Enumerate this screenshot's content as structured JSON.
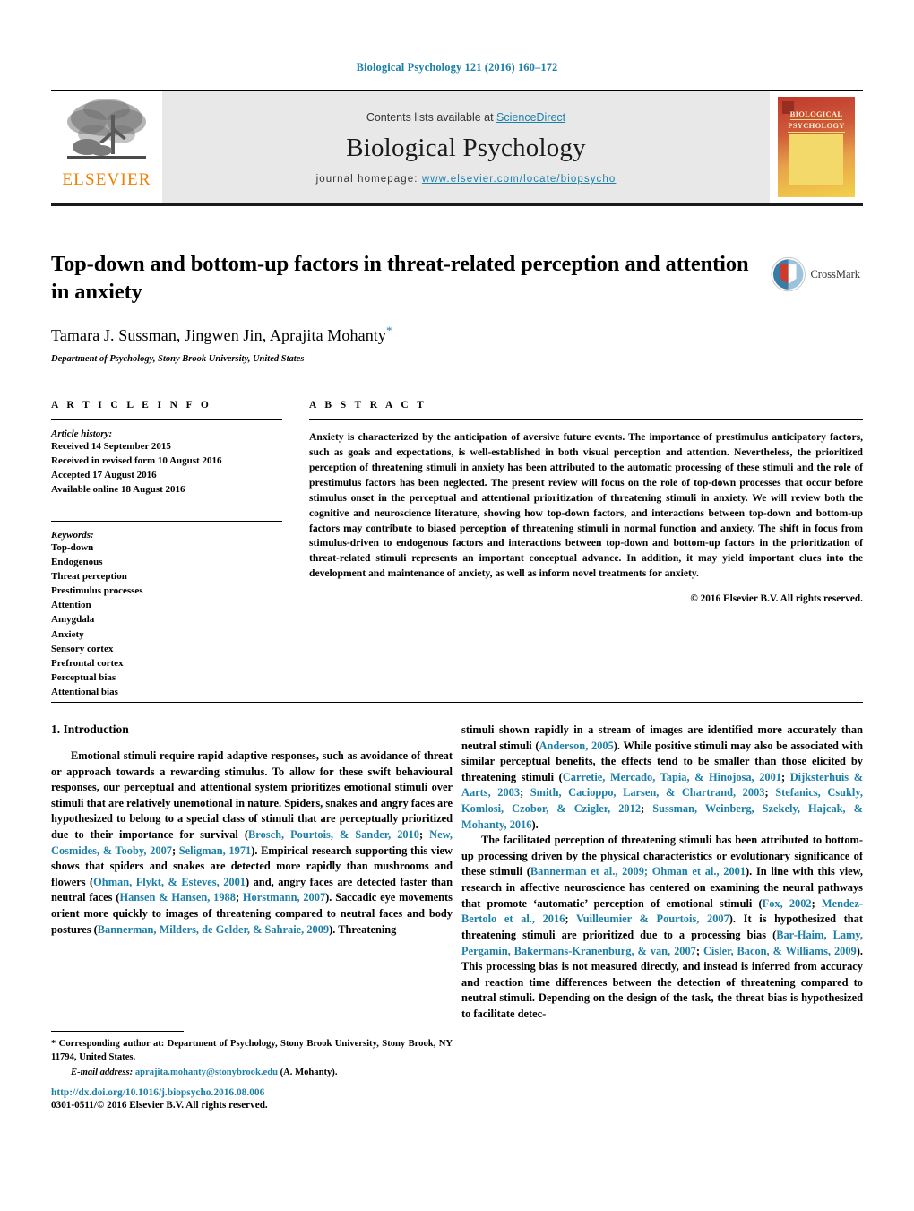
{
  "running_head": "Biological Psychology 121 (2016) 160–172",
  "masthead": {
    "contents_prefix": "Contents lists available at ",
    "sciencedirect": "ScienceDirect",
    "journal_title": "Biological Psychology",
    "homepage_prefix": "journal homepage: ",
    "homepage_url": "www.elsevier.com/locate/biopsycho",
    "publisher_wordmark": "ELSEVIER",
    "cover_title_line1": "BIOLOGICAL",
    "cover_title_line2": "PSYCHOLOGY"
  },
  "article": {
    "title": "Top-down and bottom-up factors in threat-related perception and attention in anxiety",
    "authors": "Tamara J. Sussman, Jingwen Jin, Aprajita Mohanty",
    "corresponding_marker": "*",
    "affiliation": "Department of Psychology, Stony Brook University, United States",
    "crossmark_label": "CrossMark"
  },
  "article_info": {
    "heading": "A R T I C L E   I N F O",
    "history_label": "Article history:",
    "history": [
      "Received 14 September 2015",
      "Received in revised form 10 August 2016",
      "Accepted 17 August 2016",
      "Available online 18 August 2016"
    ],
    "keywords_label": "Keywords:",
    "keywords": [
      "Top-down",
      "Endogenous",
      "Threat perception",
      "Prestimulus processes",
      "Attention",
      "Amygdala",
      "Anxiety",
      "Sensory cortex",
      "Prefrontal cortex",
      "Perceptual bias",
      "Attentional bias"
    ]
  },
  "abstract": {
    "heading": "A B S T R A C T",
    "text": "Anxiety is characterized by the anticipation of aversive future events. The importance of prestimulus anticipatory factors, such as goals and expectations, is well-established in both visual perception and attention. Nevertheless, the prioritized perception of threatening stimuli in anxiety has been attributed to the automatic processing of these stimuli and the role of prestimulus factors has been neglected. The present review will focus on the role of top-down processes that occur before stimulus onset in the perceptual and attentional prioritization of threatening stimuli in anxiety. We will review both the cognitive and neuroscience literature, showing how top-down factors, and interactions between top-down and bottom-up factors may contribute to biased perception of threatening stimuli in normal function and anxiety. The shift in focus from stimulus-driven to endogenous factors and interactions between top-down and bottom-up factors in the prioritization of threat-related stimuli represents an important conceptual advance. In addition, it may yield important clues into the development and maintenance of anxiety, as well as inform novel treatments for anxiety.",
    "copyright": "© 2016 Elsevier B.V. All rights reserved."
  },
  "body": {
    "section_heading": "1.  Introduction",
    "left_paragraph_1": {
      "p1": "Emotional stimuli require rapid adaptive responses, such as avoidance of threat or approach towards a rewarding stimulus. To allow for these swift behavioural responses, our perceptual and attentional system prioritizes emotional stimuli over stimuli that are relatively unemotional in nature. Spiders, snakes and angry faces are hypothesized to belong to a special class of stimuli that are perceptually prioritized due to their importance for survival (",
      "c1": "Brosch, Pourtois, & Sander, 2010",
      "p2": "; ",
      "c2": "New, Cosmides, & Tooby, 2007",
      "p3": "; ",
      "c3": "Seligman, 1971",
      "p4": "). Empirical research supporting this view shows that spiders and snakes are detected more rapidly than mushrooms and flowers (",
      "c4": "Ohman, Flykt, & Esteves, 2001",
      "p5": ") and, angry faces are detected faster than neutral faces (",
      "c5": "Hansen & Hansen, 1988",
      "p6": "; ",
      "c6": "Horstmann, 2007",
      "p7": "). Saccadic eye movements orient more quickly to images of threatening compared to neutral faces and body postures (",
      "c7": "Bannerman, Milders, de Gelder, & Sahraie, 2009",
      "p8": "). Threatening"
    },
    "right_paragraph_1": {
      "p1": "stimuli shown rapidly in a stream of images are identified more accurately than neutral stimuli (",
      "c1": "Anderson, 2005",
      "p2": "). While positive stimuli may also be associated with similar perceptual benefits, the effects tend to be smaller than those elicited by threatening stimuli (",
      "c2": "Carretie, Mercado, Tapia, & Hinojosa, 2001",
      "p3": "; ",
      "c3": "Dijksterhuis & Aarts, 2003",
      "p4": "; ",
      "c4": "Smith, Cacioppo, Larsen, & Chartrand, 2003",
      "p5": "; ",
      "c5": "Stefanics, Csukly, Komlosi, Czobor, & Czigler, 2012",
      "p6": "; ",
      "c6": "Sussman, Weinberg, Szekely, Hajcak, & Mohanty, 2016",
      "p7": ")."
    },
    "right_paragraph_2": {
      "p1": "The facilitated perception of threatening stimuli has been attributed to bottom-up processing driven by the physical characteristics or evolutionary significance of these stimuli (",
      "c1": "Bannerman et al., 2009; Ohman et al., 2001",
      "p2": "). In line with this view, research in affective neuroscience has centered on examining the neural pathways that promote ‘automatic’ perception of emotional stimuli (",
      "c2": "Fox, 2002",
      "p3": "; ",
      "c3": "Mendez-Bertolo et al., 2016",
      "p4": "; ",
      "c4": "Vuilleumier & Pourtois, 2007",
      "p5": "). It is hypothesized that threatening stimuli are prioritized due to a processing bias (",
      "c5": "Bar-Haim, Lamy, Pergamin, Bakermans-Kranenburg, & van, 2007",
      "p6": "; ",
      "c6": "Cisler, Bacon, & Williams, 2009",
      "p7": "). This processing bias is not measured directly, and instead is inferred from accuracy and reaction time differences between the detection of threatening compared to neutral stimuli. Depending on the design of the task, the threat bias is hypothesized to facilitate detec-"
    }
  },
  "footer": {
    "corresponding_marker": "*",
    "corresponding_text": " Corresponding author at: Department of Psychology, Stony Brook University, Stony Brook, NY 11794, United States.",
    "email_label": "E-mail address:",
    "email": "aprajita.mohanty@stonybrook.edu",
    "email_suffix": " (A. Mohanty).",
    "doi": "http://dx.doi.org/10.1016/j.biopsycho.2016.08.006",
    "issn_line": "0301-0511/© 2016 Elsevier B.V. All rights reserved."
  },
  "colors": {
    "link_blue": "#1b7fa8",
    "elsevier_orange": "#f08000",
    "band_gray": "#e8e8e8"
  }
}
